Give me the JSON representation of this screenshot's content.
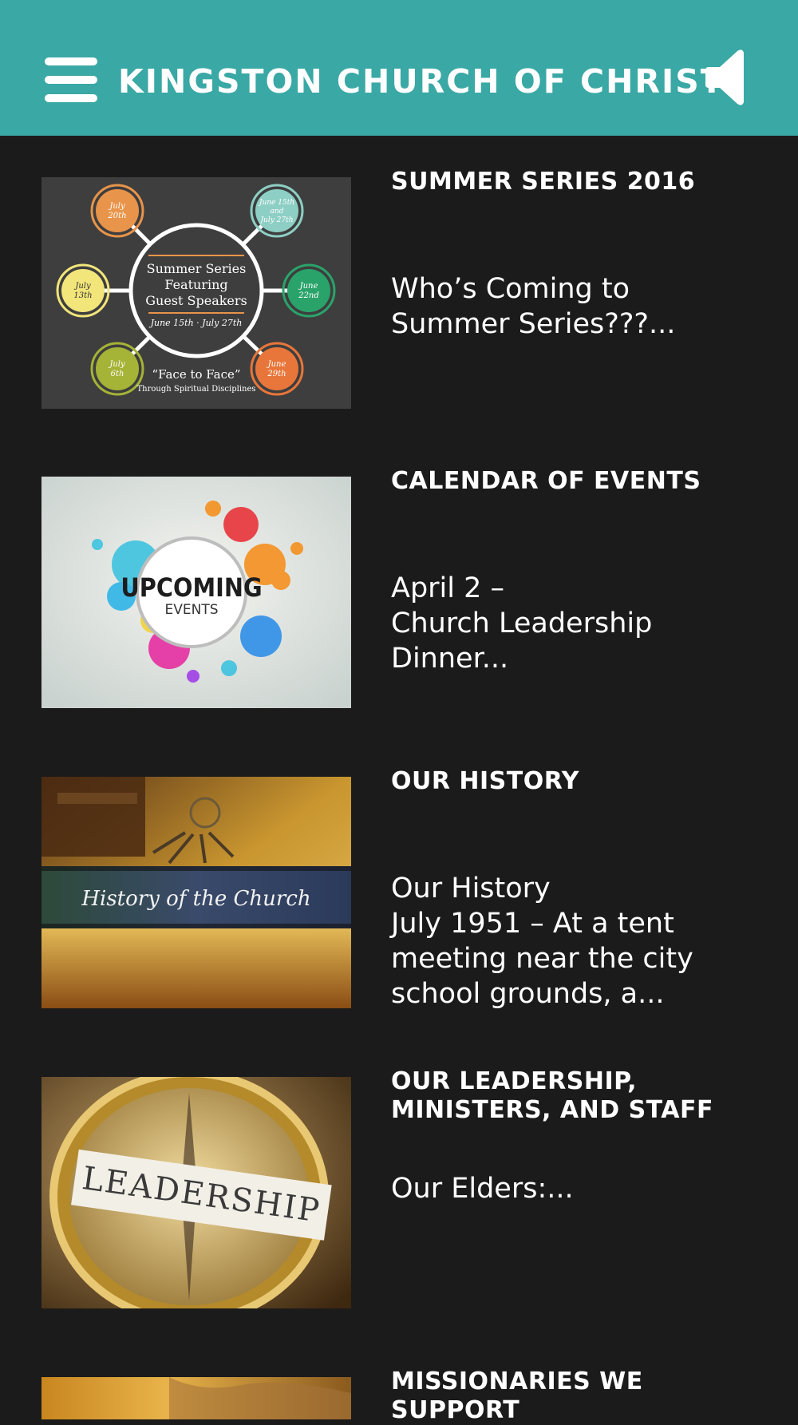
{
  "header": {
    "title": "KINGSTON CHURCH OF CHRIST",
    "menu_icon": "hamburger-menu-icon",
    "speaker_icon": "speaker-icon",
    "color": "#3aa8a5"
  },
  "background_color": "#1b1b1b",
  "posts": [
    {
      "category": "SUMMER SERIES 2016",
      "excerpt": "Who’s Coming to\nSummer Series???...",
      "image": {
        "center_lines": [
          "Summer Series",
          "Featuring",
          "Guest Speakers"
        ],
        "dates": "June 15th · July 27th",
        "tagline": "“Face to Face”",
        "subtagline": "Through Spiritual Disciplines",
        "circles": [
          {
            "label1": "July",
            "label2": "20th",
            "color": "#e8944a"
          },
          {
            "label1": "June 15th",
            "label2": "and",
            "label3": "July 27th",
            "color": "#8ecfc5"
          },
          {
            "label1": "July",
            "label2": "13th",
            "color": "#f2e57a"
          },
          {
            "label1": "June",
            "label2": "22nd",
            "color": "#2aa36b"
          },
          {
            "label1": "July",
            "label2": "6th",
            "color": "#a5b336"
          },
          {
            "label1": "June",
            "label2": "29th",
            "color": "#e8763a"
          }
        ]
      }
    },
    {
      "category": "CALENDAR OF EVENTS",
      "excerpt": "April 2 –\nChurch Leadership\nDinner...",
      "image": {
        "line1": "UPCOMING",
        "line2": "EVENTS"
      }
    },
    {
      "category": "OUR HISTORY",
      "excerpt": "Our History\nJuly 1951 – At a tent\nmeeting near the city\nschool grounds, a...",
      "image": {
        "caption": "History of the Church"
      }
    },
    {
      "category": "OUR LEADERSHIP, MINISTERS, AND STAFF",
      "excerpt": "Our Elders:...",
      "image": {
        "caption": "LEADERSHIP"
      }
    },
    {
      "category": "MISSIONARIES WE SUPPORT",
      "excerpt": ""
    }
  ]
}
